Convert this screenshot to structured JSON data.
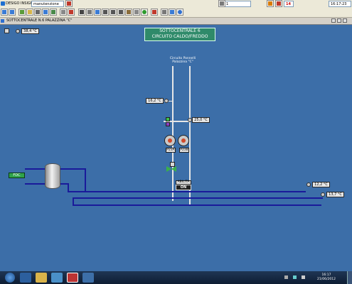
{
  "menubar": {
    "app_name": "DESIGO INSIGHT",
    "user_field": "manutenzione",
    "zone_field": "1",
    "alarm_count": "14",
    "clock": "16:17:23"
  },
  "window": {
    "title": "SOTTOCENTRALE N.6 PALAZZINA \"C\""
  },
  "schema": {
    "outdoor_temp": "38,4 °C",
    "header_line1": "SOTTOCENTRALE 6",
    "header_line2": "CIRCUITO CALDO/FREDDO",
    "circuit_label_line1": "Circuito Pannelli",
    "circuit_label_line2": "Palazzina \"C\"",
    "return_temp": "16,2 °C",
    "supply_temp": "25,0 °C",
    "pump_a_label": "P23A",
    "pump_b_label": "P23B",
    "valve_label": "ABILITA",
    "valve_state": "ON",
    "tank_label": "FDC",
    "main_supply_temp": "12,2 °C",
    "main_return_temp": "13,7 °C"
  },
  "colors": {
    "background": "#3c6ea8",
    "pipe": "#1a1a9a",
    "header_box": "#2f8a6a",
    "tank_label_bg": "#2fa34a",
    "state_on_bg": "#222222"
  },
  "taskbar": {
    "time": "16:17",
    "date": "21/06/2012"
  }
}
